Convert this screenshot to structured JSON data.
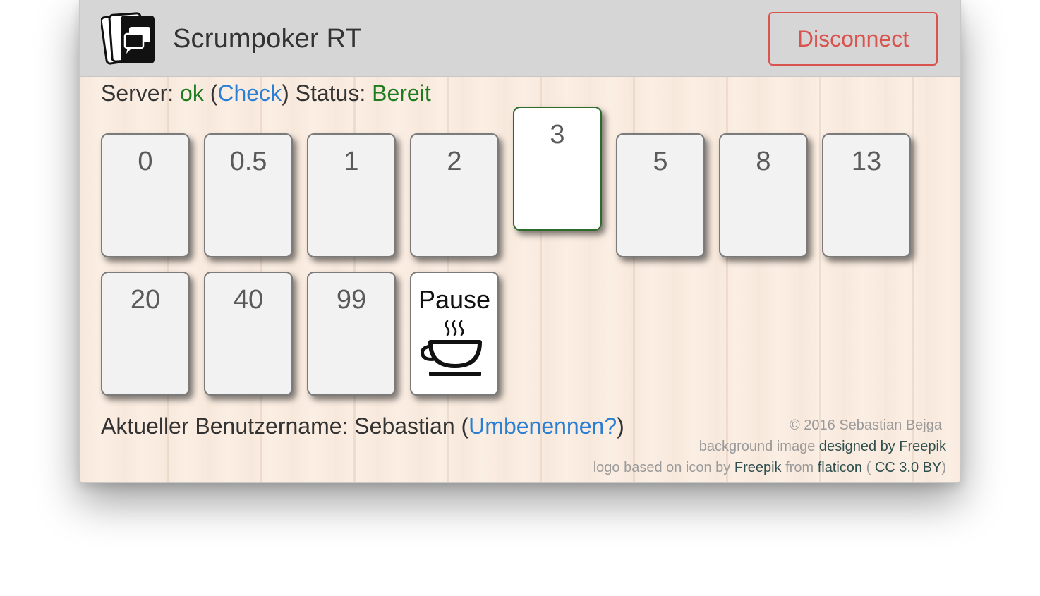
{
  "header": {
    "title": "Scrumpoker RT",
    "disconnect_label": "Disconnect"
  },
  "status": {
    "server_label": "Server: ",
    "server_value": "ok",
    "open_paren": " (",
    "check_link": "Check",
    "close_paren": ")",
    "status_label": " Status: ",
    "status_value": "Bereit"
  },
  "cards": [
    "0",
    "0.5",
    "1",
    "2",
    "3",
    "5",
    "8",
    "13",
    "20",
    "40",
    "99",
    "Pause"
  ],
  "selected_card": "3",
  "user": {
    "label": "Aktueller Benutzername: ",
    "name": "Sebastian",
    "open_paren": " (",
    "rename_link": "Umbenennen?",
    "close_paren": ")"
  },
  "footer": {
    "copyright": "© 2016 Sebastian Bejga",
    "bg_prefix": "background image ",
    "bg_link": "designed by Freepik",
    "logo_prefix": "logo based on icon by ",
    "logo_author_link": "Freepik",
    "logo_from": " from ",
    "logo_site_link": "flaticon",
    "license_open": " ( ",
    "license_link": "CC 3.0 BY",
    "license_close": ")"
  },
  "colors": {
    "accent_green": "#1e7b1e",
    "link_blue": "#2a7fd4",
    "danger_red": "#d9534f"
  },
  "icons": {
    "logo": "cards-chat-logo-icon",
    "pause": "coffee-cup-icon"
  }
}
